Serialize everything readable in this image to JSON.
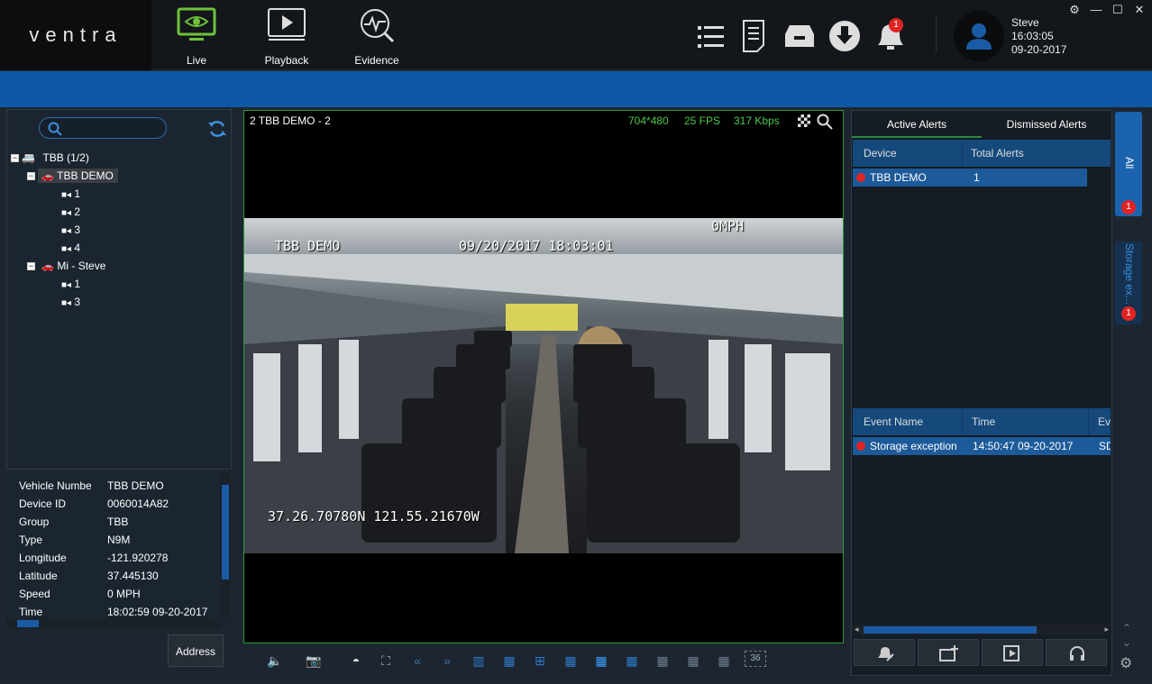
{
  "app": {
    "logo": "ventra"
  },
  "nav": [
    {
      "label": "Live",
      "icon": "monitor-eye-icon",
      "active": true,
      "color": "#6ec23b"
    },
    {
      "label": "Playback",
      "icon": "playback-icon"
    },
    {
      "label": "Evidence",
      "icon": "evidence-search-icon"
    }
  ],
  "toolbar": {
    "icons": [
      "list-icon",
      "report-icon",
      "archive-icon",
      "download-icon",
      "bell-icon"
    ],
    "bell_badge": "1"
  },
  "user": {
    "name": "Steve",
    "time": "16:03:05",
    "date": "09-20-2017"
  },
  "tree": {
    "search_placeholder": "",
    "root": "TBB (1/2)",
    "vehicles": [
      {
        "name": "TBB DEMO",
        "channels": [
          "1",
          "2",
          "3",
          "4"
        ]
      },
      {
        "name": "Mi - Steve",
        "channels": [
          "1",
          "3"
        ]
      }
    ]
  },
  "info": {
    "rows": [
      {
        "key": "Vehicle Numbe",
        "value": "TBB DEMO"
      },
      {
        "key": "Device ID",
        "value": "0060014A82"
      },
      {
        "key": "Group",
        "value": "TBB"
      },
      {
        "key": "Type",
        "value": "N9M"
      },
      {
        "key": "Longitude",
        "value": "-121.920278"
      },
      {
        "key": "Latitude",
        "value": "37.445130"
      },
      {
        "key": "Speed",
        "value": "0 MPH"
      },
      {
        "key": "Time",
        "value": "18:02:59 09-20-2017"
      }
    ],
    "address_button": "Address"
  },
  "video": {
    "title": "2 TBB DEMO - 2",
    "resolution": "704*480",
    "fps": "25 FPS",
    "bitrate": "317 Kbps",
    "osd": {
      "vehicle": "TBB DEMO",
      "datetime": "09/20/2017  18:03:01",
      "speed": "0MPH",
      "gps": "37.26.70780N 121.55.21670W"
    }
  },
  "video_controls": {
    "grid_label": "36"
  },
  "alerts": {
    "tabs": [
      "Active Alerts",
      "Dismissed Alerts"
    ],
    "device_headers": [
      "Device",
      "Total Alerts"
    ],
    "device_rows": [
      {
        "device": "TBB DEMO",
        "total": "1"
      }
    ],
    "event_headers": [
      "Event Name",
      "Time",
      "Ev"
    ],
    "event_rows": [
      {
        "name": "Storage exception",
        "time": "14:50:47 09-20-2017",
        "extra": "SD"
      }
    ]
  },
  "side_tabs": [
    {
      "label": "All",
      "badge": "1"
    },
    {
      "label": "Storage ex...",
      "badge": "1"
    }
  ]
}
